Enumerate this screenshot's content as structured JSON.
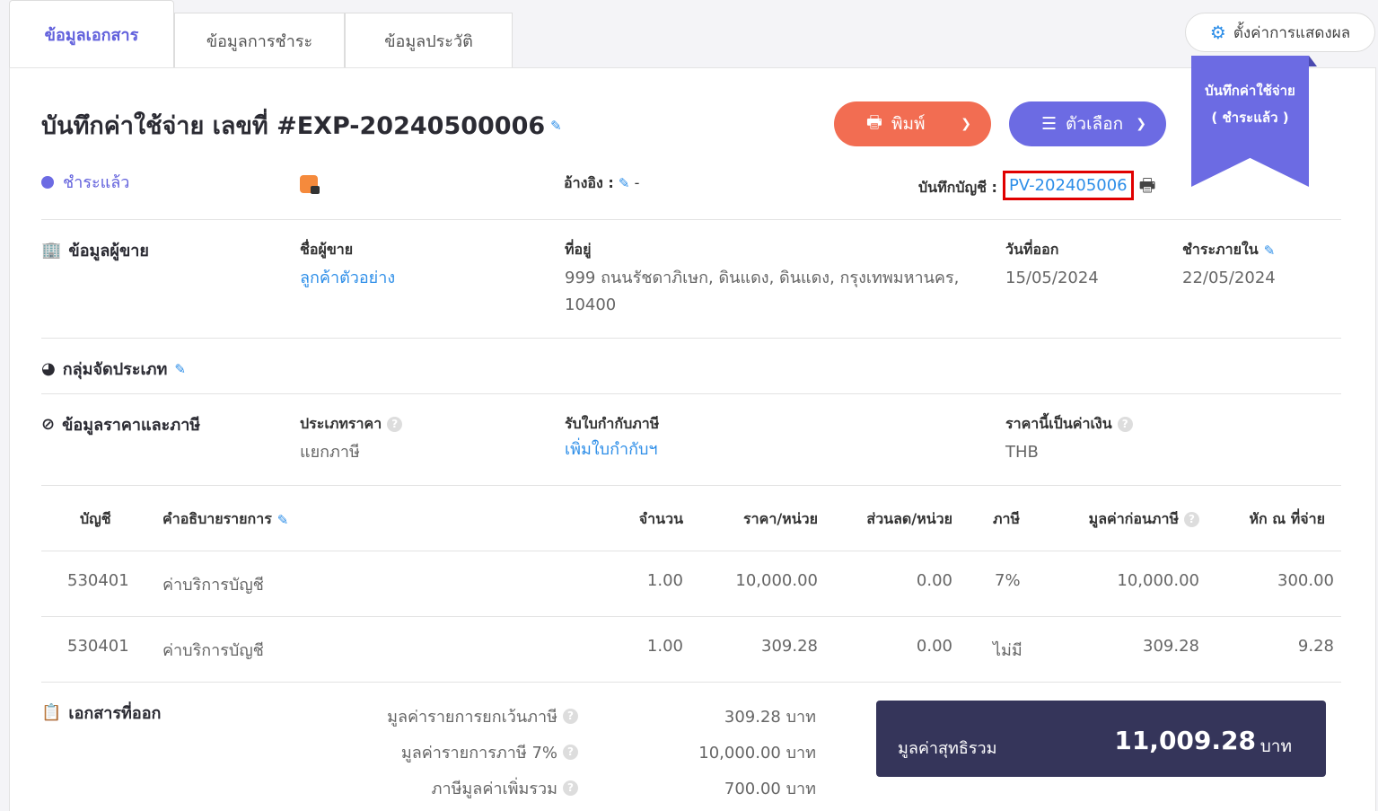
{
  "tabs": [
    "ข้อมูลเอกสาร",
    "ข้อมูลการชำระ",
    "ข้อมูลประวัติ"
  ],
  "settings_label": "ตั้งค่าการแสดงผล",
  "ribbon": {
    "line1": "บันทึกค่าใช้จ่าย",
    "line2": "( ชำระแล้ว )"
  },
  "title": "บันทึกค่าใช้จ่าย เลขที่ #EXP-20240500006",
  "buttons": {
    "print": "พิมพ์",
    "options": "ตัวเลือก"
  },
  "status": "ชำระแล้ว",
  "reference": {
    "label": "อ้างอิง :",
    "value": "-"
  },
  "account_record": {
    "label": "บันทึกบัญชี :",
    "value": "PV-202405006"
  },
  "vendor": {
    "section": "ข้อมูลผู้ขาย",
    "name_label": "ชื่อผู้ขาย",
    "name": "ลูกค้าตัวอย่าง",
    "address_label": "ที่อยู่",
    "address": "999 ถนนรัชดาภิเษก, ดินแดง, ดินแดง, กรุงเทพมหานคร, 10400",
    "issue_label": "วันที่ออก",
    "issue_date": "15/05/2024",
    "due_label": "ชำระภายใน",
    "due_date": "22/05/2024"
  },
  "category_section": "กลุ่มจัดประเภท",
  "price_tax": {
    "section": "ข้อมูลราคาและภาษี",
    "price_type_label": "ประเภทราคา",
    "price_type": "แยกภาษี",
    "tax_invoice_label": "รับใบกำกับภาษี",
    "tax_invoice_link": "เพิ่มใบกำกับฯ",
    "currency_label": "ราคานี้เป็นค่าเงิน",
    "currency": "THB"
  },
  "table": {
    "headers": [
      "บัญชี",
      "คำอธิบายรายการ",
      "จำนวน",
      "ราคา/หน่วย",
      "ส่วนลด/หน่วย",
      "ภาษี",
      "มูลค่าก่อนภาษี",
      "หัก ณ ที่จ่าย"
    ],
    "rows": [
      [
        "530401",
        "ค่าบริการบัญชี",
        "1.00",
        "10,000.00",
        "0.00",
        "7%",
        "10,000.00",
        "300.00"
      ],
      [
        "530401",
        "ค่าบริการบัญชี",
        "1.00",
        "309.28",
        "0.00",
        "ไม่มี",
        "309.28",
        "9.28"
      ]
    ]
  },
  "issued_docs_section": "เอกสารที่ออก",
  "summary": [
    {
      "label": "มูลค่ารายการยกเว้นภาษี",
      "value": "309.28 บาท"
    },
    {
      "label": "มูลค่ารายการภาษี 7%",
      "value": "10,000.00 บาท"
    },
    {
      "label": "ภาษีมูลค่าเพิ่มรวม",
      "value": "700.00 บาท"
    }
  ],
  "total": {
    "label": "มูลค่าสุทธิรวม",
    "amount": "11,009.28",
    "unit": "บาท"
  }
}
